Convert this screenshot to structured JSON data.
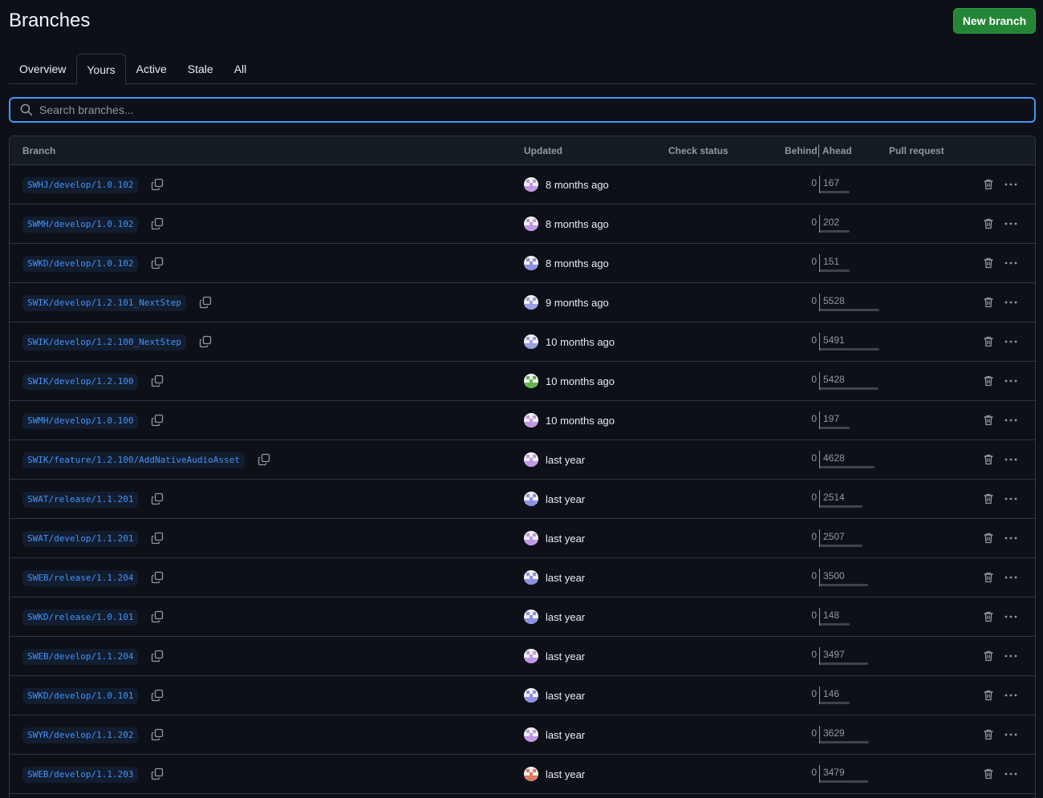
{
  "header": {
    "title": "Branches",
    "new_branch_label": "New branch"
  },
  "tabs": [
    {
      "label": "Overview",
      "active": false
    },
    {
      "label": "Yours",
      "active": true
    },
    {
      "label": "Active",
      "active": false
    },
    {
      "label": "Stale",
      "active": false
    },
    {
      "label": "All",
      "active": false
    }
  ],
  "search": {
    "placeholder": "Search branches..."
  },
  "table": {
    "columns": {
      "branch": "Branch",
      "updated": "Updated",
      "check_status": "Check status",
      "behind": "Behind",
      "ahead": "Ahead",
      "pull_request": "Pull request"
    },
    "rows": [
      {
        "branch": "SWHJ/develop/1.0.102",
        "updated": "8 months ago",
        "behind": "0",
        "ahead": "167",
        "avatar_color": "#c297e6"
      },
      {
        "branch": "SWMH/develop/1.0.102",
        "updated": "8 months ago",
        "behind": "0",
        "ahead": "202",
        "avatar_color": "#c297e6"
      },
      {
        "branch": "SWKD/develop/1.0.102",
        "updated": "8 months ago",
        "behind": "0",
        "ahead": "151",
        "avatar_color": "#8a93e6"
      },
      {
        "branch": "SWIK/develop/1.2.101_NextStep",
        "updated": "9 months ago",
        "behind": "0",
        "ahead": "5528",
        "avatar_color": "#9aa0e6"
      },
      {
        "branch": "SWIK/develop/1.2.100_NextStep",
        "updated": "10 months ago",
        "behind": "0",
        "ahead": "5491",
        "avatar_color": "#9aa0e6"
      },
      {
        "branch": "SWIK/develop/1.2.100",
        "updated": "10 months ago",
        "behind": "0",
        "ahead": "5428",
        "avatar_color": "#5fb84a"
      },
      {
        "branch": "SWMH/develop/1.0.100",
        "updated": "10 months ago",
        "behind": "0",
        "ahead": "197",
        "avatar_color": "#c297e6"
      },
      {
        "branch": "SWIK/feature/1.2.100/AddNativeAudioAsset",
        "updated": "last year",
        "behind": "0",
        "ahead": "4628",
        "avatar_color": "#c297e6"
      },
      {
        "branch": "SWAT/release/1.1.201",
        "updated": "last year",
        "behind": "0",
        "ahead": "2514",
        "avatar_color": "#8a93e6"
      },
      {
        "branch": "SWAT/develop/1.1.201",
        "updated": "last year",
        "behind": "0",
        "ahead": "2507",
        "avatar_color": "#c297e6"
      },
      {
        "branch": "SWEB/release/1.1.204",
        "updated": "last year",
        "behind": "0",
        "ahead": "3500",
        "avatar_color": "#8a93e6"
      },
      {
        "branch": "SWKD/release/1.0.101",
        "updated": "last year",
        "behind": "0",
        "ahead": "148",
        "avatar_color": "#8a93e6"
      },
      {
        "branch": "SWEB/develop/1.1.204",
        "updated": "last year",
        "behind": "0",
        "ahead": "3497",
        "avatar_color": "#c297e6"
      },
      {
        "branch": "SWKD/develop/1.0.101",
        "updated": "last year",
        "behind": "0",
        "ahead": "146",
        "avatar_color": "#8a93e6"
      },
      {
        "branch": "SWYR/develop/1.1.202",
        "updated": "last year",
        "behind": "0",
        "ahead": "3629",
        "avatar_color": "#c297e6"
      },
      {
        "branch": "SWEB/develop/1.1.203",
        "updated": "last year",
        "behind": "0",
        "ahead": "3479",
        "avatar_color": "#e07a5f"
      }
    ]
  },
  "icons": {
    "search": "search-icon",
    "copy": "copy-icon",
    "trash": "trash-icon",
    "more": "kebab-horizontal-icon"
  },
  "colors": {
    "background": "#0d1117",
    "accent": "#4493f8",
    "primary_button": "#238636"
  }
}
